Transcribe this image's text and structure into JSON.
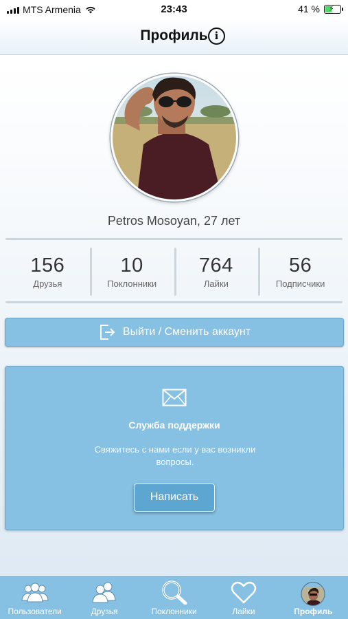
{
  "status_bar": {
    "carrier": "MTS Armenia",
    "time": "23:43",
    "battery": "41 %",
    "battery_level": 0.41
  },
  "nav": {
    "title": "Профиль"
  },
  "profile": {
    "name": "Petros Mosoyan, 27 лет"
  },
  "stats": [
    {
      "value": "156",
      "label": "Друзья"
    },
    {
      "value": "10",
      "label": "Поклонники"
    },
    {
      "value": "764",
      "label": "Лайки"
    },
    {
      "value": "56",
      "label": "Подписчики"
    }
  ],
  "logout": {
    "label": "Выйти / Сменить аккаунт"
  },
  "support": {
    "title": "Служба поддержки",
    "text": "Свяжитесь с нами если у вас возникли вопросы.",
    "button_label": "Написать"
  },
  "tabs": [
    {
      "label": "Пользователи",
      "icon": "users-icon"
    },
    {
      "label": "Друзья",
      "icon": "friends-icon"
    },
    {
      "label": "Поклонники",
      "icon": "search-icon"
    },
    {
      "label": "Лайки",
      "icon": "heart-icon"
    },
    {
      "label": "Профиль",
      "icon": "profile-avatar",
      "active": true
    }
  ],
  "colors": {
    "accent": "#86c0e2",
    "accent_border": "#6fa6c7",
    "button_dark": "#5ea6d2",
    "battery_green": "#4cd964"
  }
}
